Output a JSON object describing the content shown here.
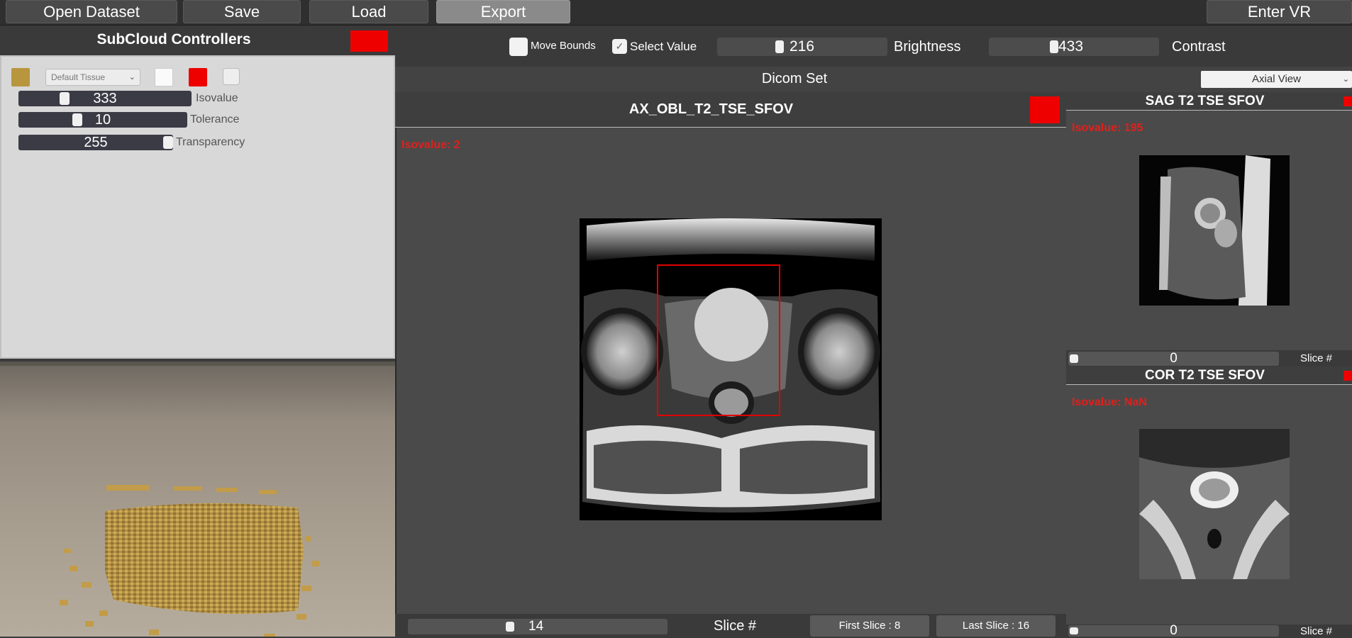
{
  "toolbar": {
    "open_dataset": "Open Dataset",
    "save": "Save",
    "load": "Load",
    "export": "Export",
    "enter_vr": "Enter VR"
  },
  "left_panel": {
    "title": "SubCloud Controllers",
    "tissue_dropdown": "Default Tissue",
    "sliders": [
      {
        "label": "Isovalue",
        "value": "333",
        "level": 0.21
      },
      {
        "label": "Tolerance",
        "value": "10",
        "level": 0.35
      },
      {
        "label": "Transparency",
        "value": "255",
        "level": 1.0
      }
    ],
    "colors": {
      "swatch": "#b8963e",
      "accent": "#ee0000",
      "scene_points": "#b89a48"
    }
  },
  "view_controls": {
    "move_bounds": "Move Bounds",
    "select_value": "Select Value",
    "select_value_checked": true,
    "brightness": {
      "label": "Brightness",
      "value": "216",
      "level": 0.37
    },
    "contrast": {
      "label": "Contrast",
      "value": "433",
      "level": 0.39
    }
  },
  "dicom": {
    "title": "Dicom Set",
    "view_select": "Axial View"
  },
  "main_view": {
    "title": "AX_OBL_T2_TSE_SFOV",
    "isovalue": "Isovalue: 2",
    "slice_value": "14",
    "slice_label": "Slice #",
    "first_slice": "First Slice : 8",
    "last_slice": "Last Slice : 16"
  },
  "side_views": [
    {
      "title": "SAG T2 TSE SFOV",
      "isovalue": "Isovalue: 195",
      "slice_value": "0",
      "slice_label": "Slice #"
    },
    {
      "title": "COR T2 TSE SFOV",
      "isovalue": "Isovalue: NaN",
      "slice_value": "0",
      "slice_label": "Slice #"
    }
  ]
}
